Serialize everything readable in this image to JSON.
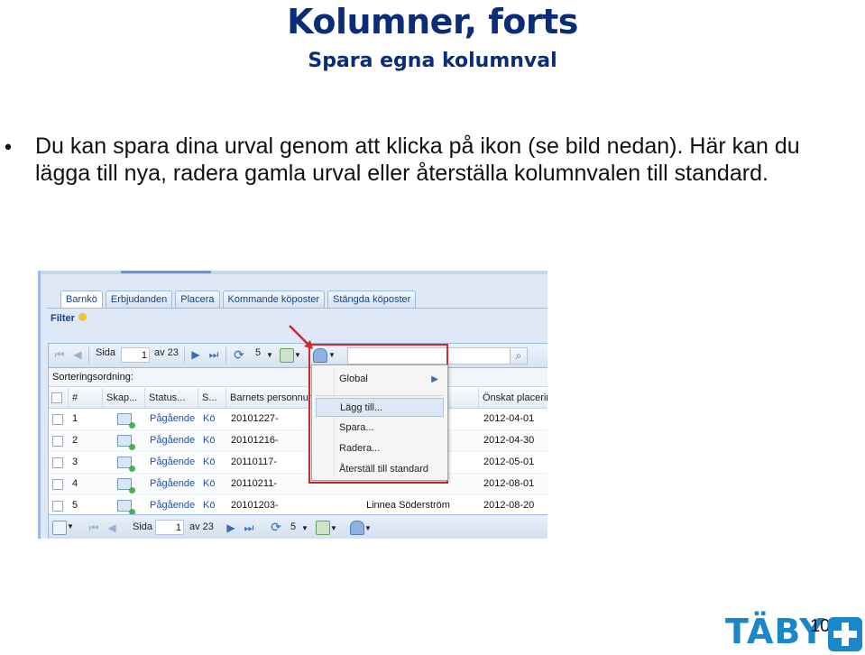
{
  "slide": {
    "title": "Kolumner, forts",
    "subtitle": "Spara egna kolumnval",
    "bullet": "•",
    "body": "Du kan spara dina urval genom att klicka på ikon (se bild nedan). Här kan du lägga till nya, radera gamla urval eller återställa kolumnvalen till standard.",
    "page_number": "10",
    "logo_text": "TÄBY"
  },
  "tabs": [
    "Barnkö",
    "Erbjudanden",
    "Placera",
    "Kommande köposter",
    "Stängda köposter"
  ],
  "filter_label": "Filter",
  "toolbar": {
    "page_label": "Sida",
    "page_value": "1",
    "page_of": "av 23",
    "page_size": "5"
  },
  "sort_label": "Sorteringsordning:",
  "columns": [
    "#",
    "Skap...",
    "Status...",
    "S...",
    "Barnets personnum",
    "Önskat placerin"
  ],
  "rows": [
    {
      "num": "1",
      "status": "Pågående",
      "s": "Kö",
      "pnr": "20101227-",
      "name": "",
      "date": "2012-04-01"
    },
    {
      "num": "2",
      "status": "Pågående",
      "s": "Kö",
      "pnr": "20101216-",
      "name": "",
      "date": "2012-04-30"
    },
    {
      "num": "3",
      "status": "Pågående",
      "s": "Kö",
      "pnr": "20110117-",
      "name": "",
      "date": "2012-05-01"
    },
    {
      "num": "4",
      "status": "Pågående",
      "s": "Kö",
      "pnr": "20110211-",
      "name": "",
      "date": "2012-08-01"
    },
    {
      "num": "5",
      "status": "Pågående",
      "s": "Kö",
      "pnr": "20101203-",
      "name": "Linnea Söderström",
      "date": "2012-08-20"
    }
  ],
  "menu": {
    "global": "Global",
    "add": "Lägg till...",
    "save": "Spara...",
    "delete": "Radera...",
    "reset": "Återställ till standard"
  },
  "colors": {
    "title": "#0b2d78",
    "highlight_box": "#d9262b",
    "logo": "#1a87c8"
  }
}
